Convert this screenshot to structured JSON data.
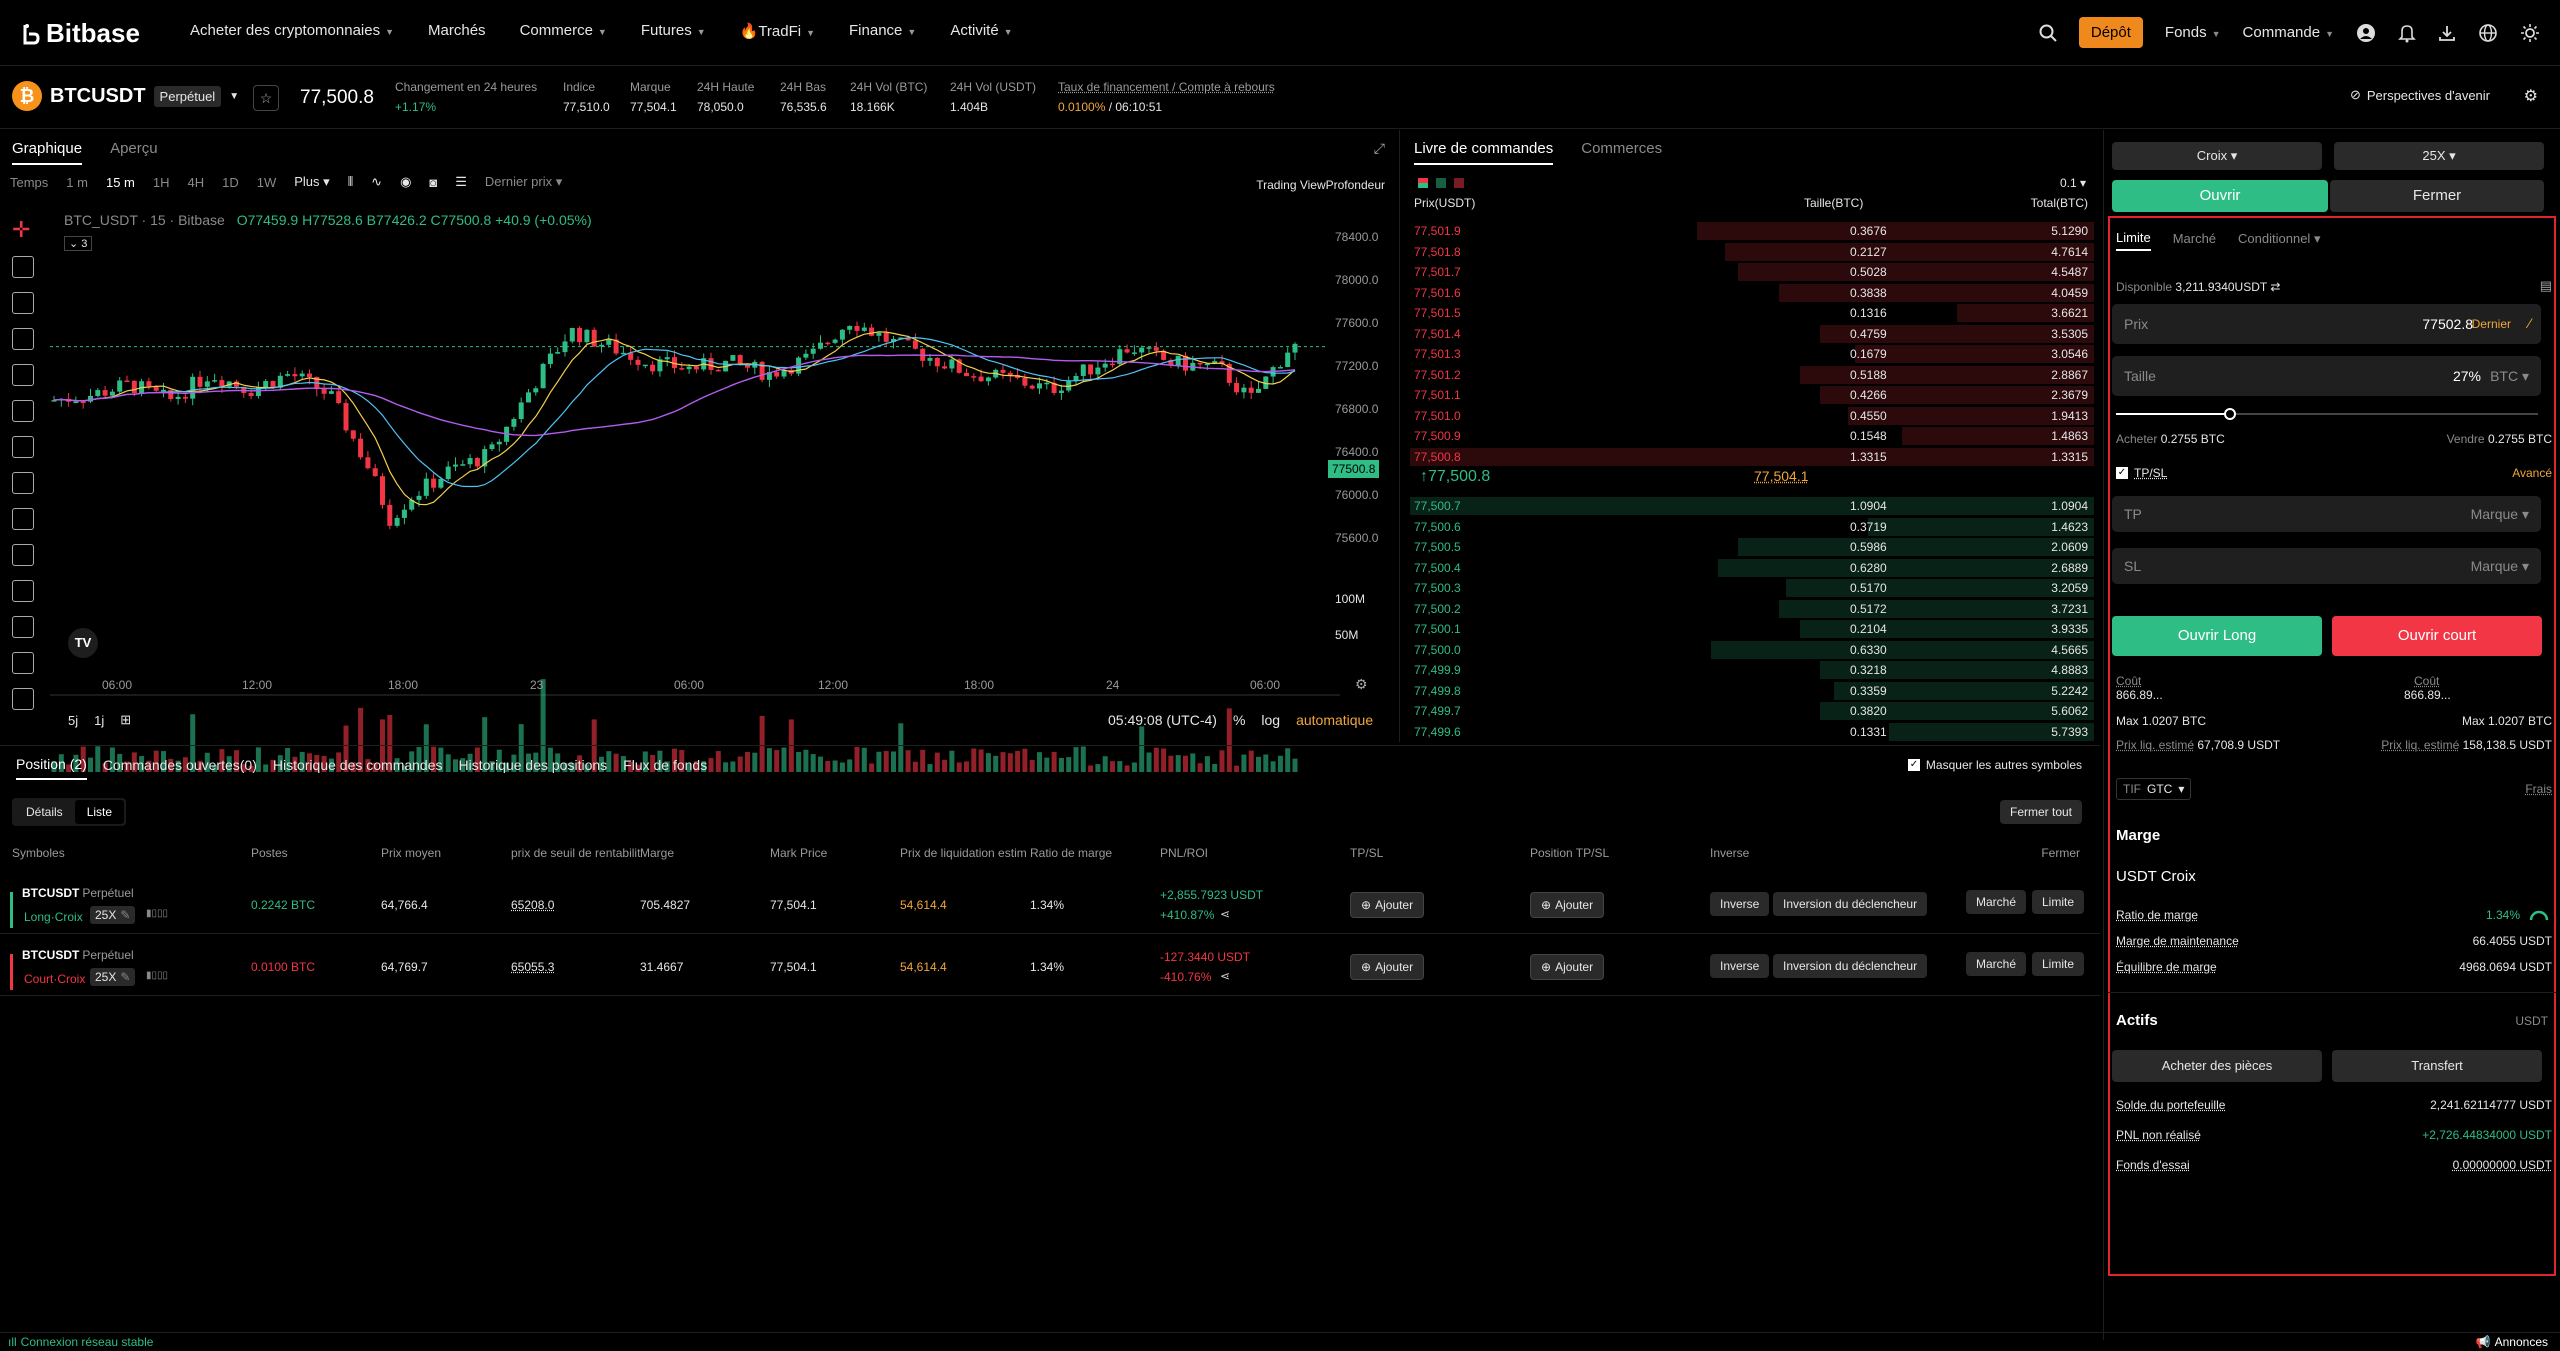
{
  "header": {
    "logo": "Bitbase",
    "nav": [
      "Acheter des cryptomonnaies",
      "Marchés",
      "Commerce",
      "Futures",
      "TradFi",
      "Finance",
      "Activité"
    ],
    "deposit": "Dépôt",
    "funds": "Fonds",
    "order": "Commande"
  },
  "ticker": {
    "symbol": "BTCUSDT",
    "type": "Perpétuel",
    "price": "77,500.8",
    "change_label": "Changement en 24 heures",
    "change_value": "+1.17%",
    "index_label": "Indice",
    "index_value": "77,510.0",
    "mark_label": "Marque",
    "mark_value": "77,504.1",
    "high_label": "24H Haute",
    "high_value": "78,050.0",
    "low_label": "24H Bas",
    "low_value": "76,535.6",
    "volbtc_label": "24H Vol (BTC)",
    "volbtc_value": "18.166K",
    "volusdt_label": "24H Vol (USDT)",
    "volusdt_value": "1.404B",
    "funding_label": "Taux de financement / Compte à rebours",
    "funding_rate": "0.0100%",
    "funding_countdown": "/ 06:10:51",
    "perspectives": "Perspectives d'avenir"
  },
  "chart": {
    "tab_graph": "Graphique",
    "tab_overview": "Aperçu",
    "time_label": "Temps",
    "intervals": [
      "1 m",
      "15 m",
      "1H",
      "4H",
      "1D",
      "1W",
      "Plus"
    ],
    "last_price": "Dernier prix",
    "view_trading": "Trading View",
    "view_depth": "Profondeur",
    "legend_title": "BTC_USDT · 15 · Bitbase",
    "legend_ohlc": "O77459.9 H77528.6 B77426.2 C77500.8 +40.9 (+0.05%)",
    "legend_count": "3",
    "price_ticks": [
      "78400.0",
      "78000.0",
      "77600.0",
      "77200.0",
      "76800.0",
      "76400.0",
      "76000.0",
      "75600.0"
    ],
    "current_price_tag": "77500.8",
    "vol_ticks": [
      "100M",
      "50M"
    ],
    "time_ticks": [
      "06:00",
      "12:00",
      "18:00",
      "23",
      "06:00",
      "12:00",
      "18:00",
      "24",
      "06:00"
    ],
    "range_5d": "5j",
    "range_1d": "1j",
    "clock": "05:49:08 (UTC-4)",
    "pct": "%",
    "log": "log",
    "auto": "automatique"
  },
  "book": {
    "tab_book": "Livre de commandes",
    "tab_trades": "Commerces",
    "precision": "0.1",
    "col_price": "Prix(USDT)",
    "col_size": "Taille(BTC)",
    "col_total": "Total(BTC)",
    "asks": [
      {
        "p": "77,501.9",
        "s": "0.3676",
        "t": "5.1290",
        "d": 0.58
      },
      {
        "p": "77,501.8",
        "s": "0.2127",
        "t": "4.7614",
        "d": 0.54
      },
      {
        "p": "77,501.7",
        "s": "0.5028",
        "t": "4.5487",
        "d": 0.52
      },
      {
        "p": "77,501.6",
        "s": "0.3838",
        "t": "4.0459",
        "d": 0.46
      },
      {
        "p": "77,501.5",
        "s": "0.1316",
        "t": "3.6621",
        "d": 0.2
      },
      {
        "p": "77,501.4",
        "s": "0.4759",
        "t": "3.5305",
        "d": 0.4
      },
      {
        "p": "77,501.3",
        "s": "0.1679",
        "t": "3.0546",
        "d": 0.35
      },
      {
        "p": "77,501.2",
        "s": "0.5188",
        "t": "2.8867",
        "d": 0.43
      },
      {
        "p": "77,501.1",
        "s": "0.4266",
        "t": "2.3679",
        "d": 0.4
      },
      {
        "p": "77,501.0",
        "s": "0.4550",
        "t": "1.9413",
        "d": 0.36
      },
      {
        "p": "77,500.9",
        "s": "0.1548",
        "t": "1.4863",
        "d": 0.28
      },
      {
        "p": "77,500.8",
        "s": "1.3315",
        "t": "1.3315",
        "d": 1.0
      }
    ],
    "mid_price": "↑77,500.8",
    "mid_mark": "77,504.1",
    "bids": [
      {
        "p": "77,500.7",
        "s": "1.0904",
        "t": "1.0904",
        "d": 1.0
      },
      {
        "p": "77,500.6",
        "s": "0.3719",
        "t": "1.4623",
        "d": 0.33
      },
      {
        "p": "77,500.5",
        "s": "0.5986",
        "t": "2.0609",
        "d": 0.52
      },
      {
        "p": "77,500.4",
        "s": "0.6280",
        "t": "2.6889",
        "d": 0.55
      },
      {
        "p": "77,500.3",
        "s": "0.5170",
        "t": "3.2059",
        "d": 0.45
      },
      {
        "p": "77,500.2",
        "s": "0.5172",
        "t": "3.7231",
        "d": 0.46
      },
      {
        "p": "77,500.1",
        "s": "0.2104",
        "t": "3.9335",
        "d": 0.43
      },
      {
        "p": "77,500.0",
        "s": "0.6330",
        "t": "4.5665",
        "d": 0.56
      },
      {
        "p": "77,499.9",
        "s": "0.3218",
        "t": "4.8883",
        "d": 0.4
      },
      {
        "p": "77,499.8",
        "s": "0.3359",
        "t": "5.2242",
        "d": 0.38
      },
      {
        "p": "77,499.7",
        "s": "0.3820",
        "t": "5.6062",
        "d": 0.4
      },
      {
        "p": "77,499.6",
        "s": "0.1331",
        "t": "5.7393",
        "d": 0.3
      }
    ]
  },
  "trade": {
    "margin_mode": "Croix",
    "leverage": "25X",
    "open": "Ouvrir",
    "close": "Fermer",
    "order_types": [
      "Limite",
      "Marché",
      "Conditionnel"
    ],
    "available_label": "Disponible",
    "available_value": "3,211.9340USDT",
    "price_label": "Prix",
    "price_value": "77502.8",
    "price_last": "Dernier",
    "size_label": "Taille",
    "size_pct": "27%",
    "size_unit": "BTC",
    "slider_fraction": 0.27,
    "buy_label": "Acheter",
    "buy_value": "0.2755 BTC",
    "sell_label": "Vendre",
    "sell_value": "0.2755 BTC",
    "tpsl": "TP/SL",
    "advanced": "Avancé",
    "tp": "TP",
    "sl": "SL",
    "mark": "Marque",
    "open_long": "Ouvrir Long",
    "open_short": "Ouvrir court",
    "cost_label": "Coût",
    "cost_left": "866.89...",
    "cost_right": "866.89...",
    "max_left": "Max 1.0207 BTC",
    "max_right": "Max 1.0207 BTC",
    "liq_label": "Prix liq. estimé",
    "liq_left": "67,708.9 USDT",
    "liq_right": "158,138.5 USDT",
    "tif": "TIF",
    "gtc": "GTC",
    "fees": "Frais",
    "margin_title": "Marge",
    "usdt_cross": "USDT Croix",
    "margin_ratio_label": "Ratio de marge",
    "margin_ratio_value": "1.34%",
    "maint_label": "Marge de maintenance",
    "maint_value": "66.4055 USDT",
    "balance_label": "Équilibre de marge",
    "balance_value": "4968.0694 USDT",
    "assets_title": "Actifs",
    "assets_unit": "USDT",
    "buy_coins": "Acheter des pièces",
    "transfer": "Transfert",
    "wallet_label": "Solde du portefeuille",
    "wallet_value": "2,241.62114777 USDT",
    "upnl_label": "PNL non réalisé",
    "upnl_value": "+2,726.44834000 USDT",
    "trial_label": "Fonds d'essai",
    "trial_value": "0.00000000 USDT"
  },
  "positions": {
    "tabs": [
      "Position (2)",
      "Commandes ouvertes(0)",
      "Historique des commandes",
      "Historique des positions",
      "Flux de fonds"
    ],
    "hide_others": "Masquer les autres symboles",
    "view_details": "Détails",
    "view_list": "Liste",
    "close_all": "Fermer tout",
    "headers": [
      "Symboles",
      "Postes",
      "Prix moyen",
      "prix de seuil de rentabilit",
      "Marge",
      "Mark Price",
      "Prix de liquidation estim",
      "Ratio de marge",
      "PNL/ROI",
      "TP/SL",
      "Position TP/SL",
      "Inverse",
      "Fermer"
    ],
    "rows": [
      {
        "symbol": "BTCUSDT",
        "type": "Perpétuel",
        "side": "Long·Croix",
        "lev": "25X",
        "size": "0.2242 BTC",
        "avg": "64,766.4",
        "be": "65208.0",
        "margin": "705.4827",
        "mark": "77,504.1",
        "liq": "54,614.4",
        "ratio": "1.34%",
        "pnl": "+2,855.7923 USDT",
        "roi": "+410.87%"
      },
      {
        "symbol": "BTCUSDT",
        "type": "Perpétuel",
        "side": "Court·Croix",
        "lev": "25X",
        "size": "0.0100 BTC",
        "avg": "64,769.7",
        "be": "65055.3",
        "margin": "31.4667",
        "mark": "77,504.1",
        "liq": "54,614.4",
        "ratio": "1.34%",
        "pnl": "-127.3440 USDT",
        "roi": "-410.76%"
      }
    ],
    "add": "Ajouter",
    "inverse": "Inverse",
    "inverse_trigger": "Inversion du déclencheur",
    "market": "Marché",
    "limit": "Limite"
  },
  "status": {
    "connection": "Connexion réseau stable",
    "announcements": "Annonces"
  },
  "colors": {
    "accent": "#f0891d",
    "up": "#2ebd85",
    "down": "#f23645",
    "highlight": "#e0252f"
  }
}
